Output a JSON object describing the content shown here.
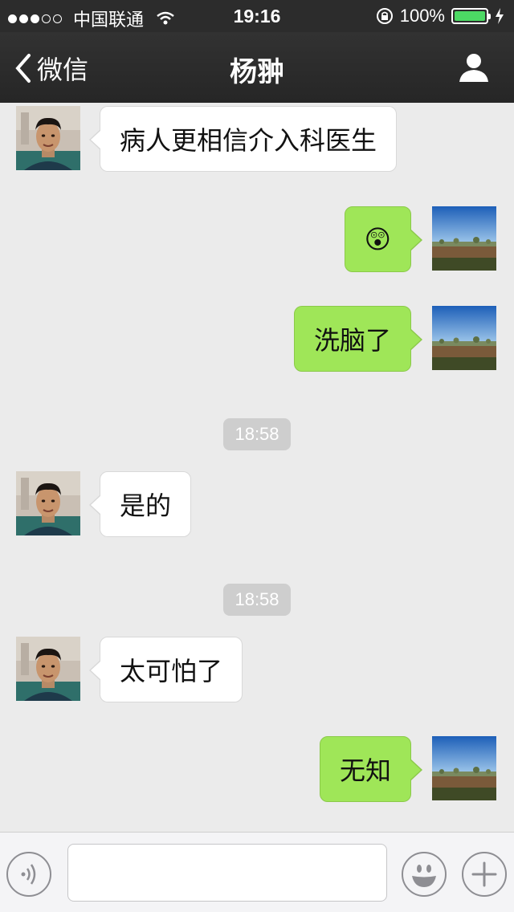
{
  "status_bar": {
    "carrier": "中国联通",
    "time": "19:16",
    "battery": "100%"
  },
  "nav": {
    "back_label": "微信",
    "title": "杨翀"
  },
  "messages": [
    {
      "from": "contact",
      "text": "病人更相信介入科医生"
    },
    {
      "from": "me",
      "text": "😲"
    },
    {
      "from": "me",
      "text": "洗脑了"
    },
    {
      "timestamp": "18:58"
    },
    {
      "from": "contact",
      "text": "是的"
    },
    {
      "timestamp": "18:58"
    },
    {
      "from": "contact",
      "text": "太可怕了"
    },
    {
      "from": "me",
      "text": "无知"
    }
  ],
  "input": {
    "placeholder": ""
  },
  "colors": {
    "outgoing_bubble": "#9fe658",
    "incoming_bubble": "#ffffff",
    "nav_bar": "#2c2c2c",
    "battery_fill": "#4cd964",
    "chat_background": "#ebebeb"
  },
  "icons": {
    "back": "chevron-left-icon",
    "profile": "person-icon",
    "voice": "voice-icon",
    "emoji": "smiley-icon",
    "more": "plus-icon",
    "wifi": "wifi-icon",
    "lock": "rotation-lock-icon",
    "charging": "lightning-icon"
  }
}
